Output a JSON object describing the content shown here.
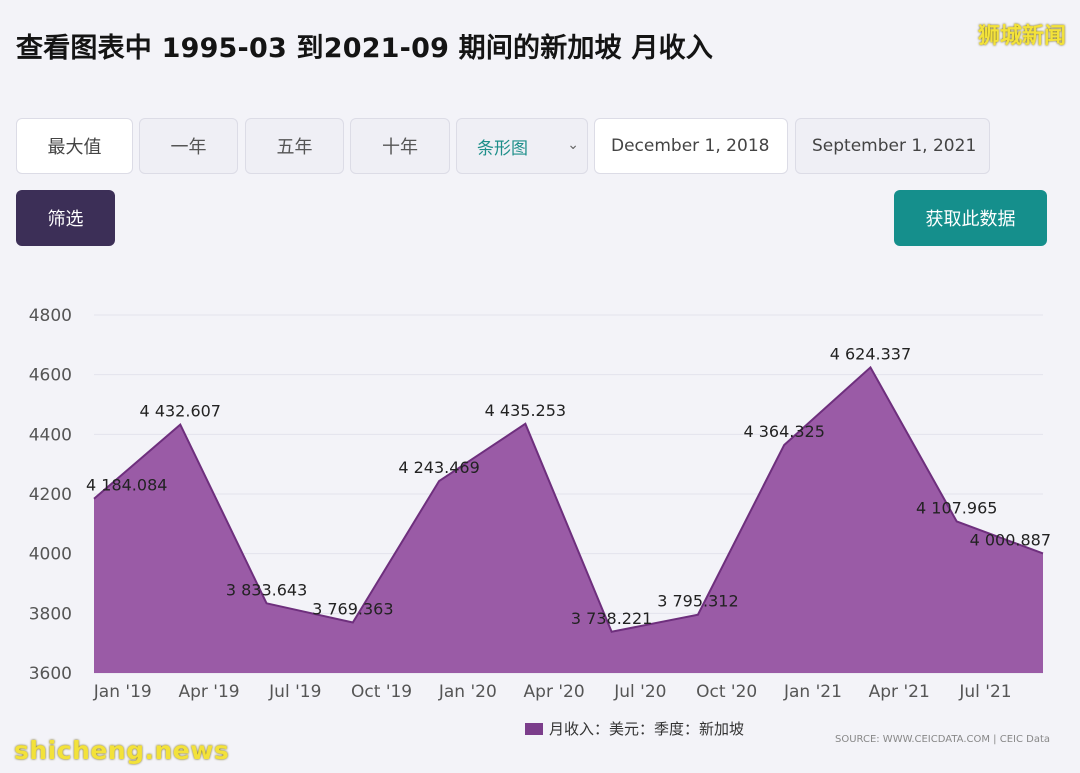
{
  "header": {
    "title": "查看图表中 1995-03 到2021-09 期间的新加坡 月收入",
    "watermark_top": "狮城新闻",
    "watermark_bottom": "shicheng.news"
  },
  "controls": {
    "range_buttons": [
      "最大值",
      "一年",
      "五年",
      "十年"
    ],
    "chart_type_select": "条形图",
    "start_date": "December 1, 2018",
    "end_date": "September 1, 2021",
    "filter_label": "筛选",
    "get_data_label": "获取此数据"
  },
  "colors": {
    "area_fill": "#9a5ba6",
    "area_stroke": "#6e2f7d",
    "filter_button": "#3c2f57",
    "get_data_button": "#158f8c"
  },
  "chart_data": {
    "type": "area",
    "x_tick_labels": [
      "Jan '19",
      "Apr '19",
      "Jul '19",
      "Oct '19",
      "Jan '20",
      "Apr '20",
      "Jul '20",
      "Oct '20",
      "Jan '21",
      "Apr '21",
      "Jul '21"
    ],
    "x": [
      "Dec 2018",
      "Mar 2019",
      "Jun 2019",
      "Sep 2019",
      "Dec 2019",
      "Mar 2020",
      "Jun 2020",
      "Sep 2020",
      "Dec 2020",
      "Mar 2021",
      "Jun 2021",
      "Sep 2021"
    ],
    "series": [
      {
        "name": "月收入：美元：季度：新加坡",
        "values": [
          4184.084,
          4432.607,
          3833.643,
          3769.363,
          4243.469,
          4435.253,
          3738.221,
          3795.312,
          4364.325,
          4624.337,
          4107.965,
          4000.887
        ]
      }
    ],
    "data_labels": [
      "4 184.084",
      "4 432.607",
      "3 833.643",
      "3 769.363",
      "4 243.469",
      "4 435.253",
      "3 738.221",
      "3 795.312",
      "4 364.325",
      "4 624.337",
      "4 107.965",
      "4 000.887"
    ],
    "y_ticks": [
      3600,
      3800,
      4000,
      4200,
      4400,
      4600,
      4800
    ],
    "ylim": [
      3600,
      4800
    ],
    "grid": true,
    "legend_position": "bottom-center",
    "source": "SOURCE: WWW.CEICDATA.COM | CEIC Data"
  }
}
